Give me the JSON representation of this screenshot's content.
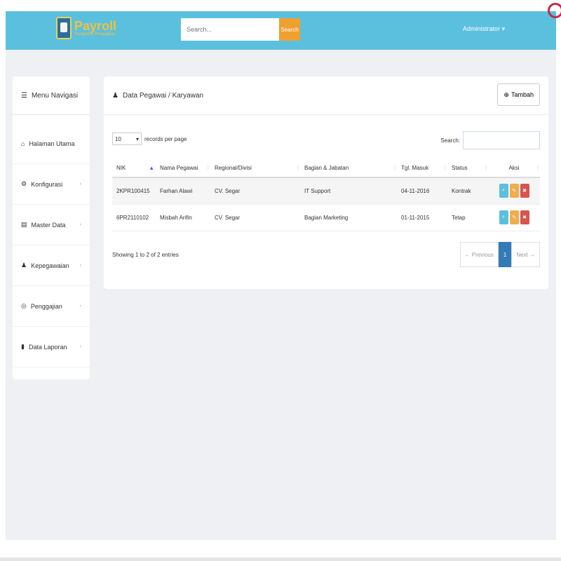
{
  "app": {
    "title": "Payroll",
    "subtitle": "Pengelola Penggajian"
  },
  "header": {
    "search_placeholder": "Search...",
    "search_button": "Search",
    "user": "Administrator"
  },
  "sidebar": {
    "title": "Menu Navigasi",
    "items": [
      {
        "label": "Halaman Utama",
        "icon": "home-icon",
        "has_children": false
      },
      {
        "label": "Konfigurasi",
        "icon": "gear-icon",
        "has_children": true
      },
      {
        "label": "Master Data",
        "icon": "database-icon",
        "has_children": true
      },
      {
        "label": "Kepegawaian",
        "icon": "user-icon",
        "has_children": true
      },
      {
        "label": "Penggajian",
        "icon": "money-icon",
        "has_children": true
      },
      {
        "label": "Data Laporan",
        "icon": "file-icon",
        "has_children": true
      }
    ]
  },
  "panel": {
    "title": "Data Pegawai / Karyawan",
    "add_button": "Tambah",
    "length_value": "10",
    "length_suffix": "records per page",
    "search_label": "Search:",
    "columns": [
      "NIK",
      "Nama Pegawai",
      "Regional/Divisi",
      "Bagian & Jabatan",
      "Tgl. Masuk",
      "Status",
      "Aksi"
    ],
    "rows": [
      {
        "nik": "2KPR100415",
        "nama": "Farhan Alawi",
        "regional": "CV. Segar",
        "bagian": "IT Support",
        "tgl": "04-11-2016",
        "status": "Kontrak"
      },
      {
        "nik": "6PR2110102",
        "nama": "Misbah Arifin",
        "regional": "CV. Segar",
        "bagian": "Bagian Marketing",
        "tgl": "01-11-2015",
        "status": "Tetap"
      }
    ],
    "info": "Showing 1 to 2 of 2 entries",
    "pager": {
      "prev": "← Previous",
      "page": "1",
      "next": "Next →"
    }
  },
  "colors": {
    "topbar": "#5bc0de",
    "search_button": "#f0a030",
    "view": "#5bc0de",
    "edit": "#f0ad4e",
    "delete": "#d9534f"
  }
}
